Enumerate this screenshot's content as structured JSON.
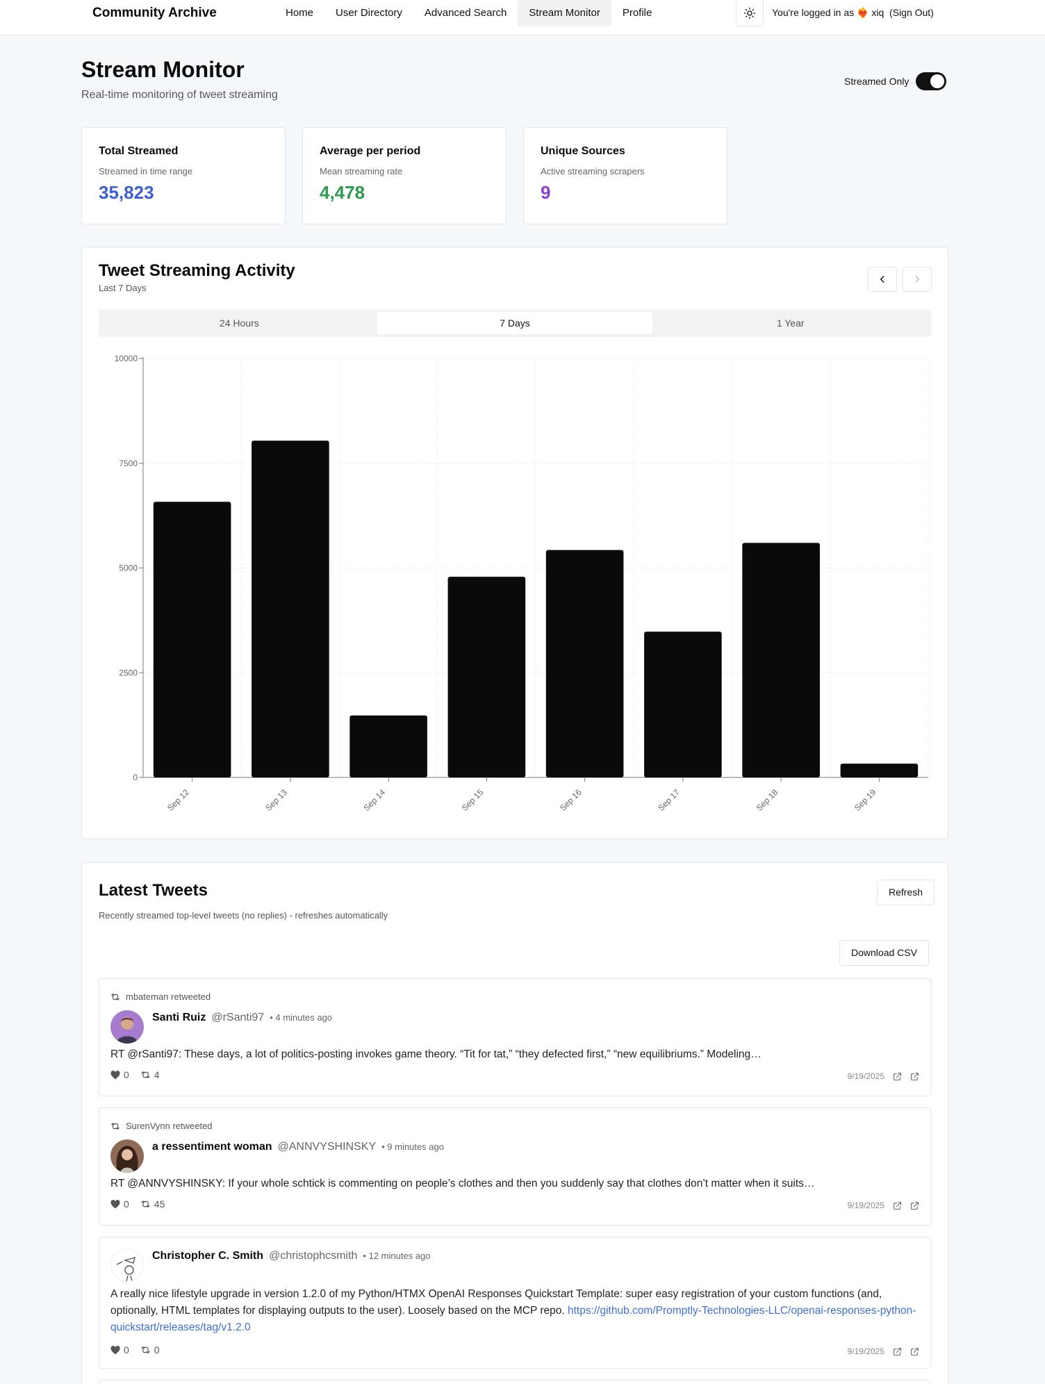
{
  "nav": {
    "brand": "Community Archive",
    "links": [
      {
        "label": "Home"
      },
      {
        "label": "User Directory"
      },
      {
        "label": "Advanced Search"
      },
      {
        "label": "Stream Monitor",
        "active": true
      },
      {
        "label": "Profile"
      }
    ],
    "theme_icon": "sun-icon",
    "login_prefix": "You're logged in as",
    "login_emoji": "❤️‍🔥",
    "username": "xiq",
    "sign_out": "(Sign Out)"
  },
  "header": {
    "title": "Stream Monitor",
    "subtitle": "Real-time monitoring of tweet streaming",
    "toggle_label": "Streamed Only",
    "toggle_on": true
  },
  "stats": [
    {
      "title": "Total Streamed",
      "desc": "Streamed in time range",
      "value": "35,823",
      "color": "#3b5fd1"
    },
    {
      "title": "Average per period",
      "desc": "Mean streaming rate",
      "value": "4,478",
      "color": "#2d9a4f"
    },
    {
      "title": "Unique Sources",
      "desc": "Active streaming scrapers",
      "value": "9",
      "color": "#8a3fd1"
    }
  ],
  "chart_card": {
    "title": "Tweet Streaming Activity",
    "subtitle": "Last 7 Days",
    "prev_icon": "chevron-left-icon",
    "next_icon": "chevron-right-icon",
    "tabs": [
      {
        "label": "24 Hours"
      },
      {
        "label": "7 Days",
        "active": true
      },
      {
        "label": "1 Year"
      }
    ]
  },
  "chart_data": {
    "type": "bar",
    "categories": [
      "Sep 12",
      "Sep 13",
      "Sep 14",
      "Sep 15",
      "Sep 16",
      "Sep 17",
      "Sep 18",
      "Sep 19"
    ],
    "values": [
      6580,
      8040,
      1480,
      4790,
      5430,
      3480,
      5600,
      330
    ],
    "ylim": [
      0,
      10000
    ],
    "yticks": [
      0,
      2500,
      5000,
      7500,
      10000
    ],
    "grid": true,
    "bar_color": "#0a0a0c"
  },
  "tweets_section": {
    "title": "Latest Tweets",
    "subtitle": "Recently streamed top-level tweets (no replies) - refreshes automatically",
    "refresh_label": "Refresh",
    "download_label": "Download CSV"
  },
  "tweets": [
    {
      "retweeted_by": "mbateman retweeted",
      "name": "Santi Ruiz",
      "handle": "@rSanti97",
      "time": "• 4 minutes ago",
      "text": "RT @rSanti97: These days, a lot of politics-posting invokes game theory. “Tit for tat,” “they defected first,” “new equilibriums.” Modeling…",
      "link": "",
      "likes": "0",
      "retweets": "4",
      "date": "9/19/2025",
      "avatar_color": "#a67ccf"
    },
    {
      "retweeted_by": "SurenVynn retweeted",
      "name": "a ressentiment woman",
      "handle": "@ANNVYSHINSKY",
      "time": "• 9 minutes ago",
      "text": "RT @ANNVYSHINSKY: If your whole schtick is commenting on people’s clothes and then you suddenly say that clothes don’t matter when it suits…",
      "link": "",
      "likes": "0",
      "retweets": "45",
      "date": "9/19/2025",
      "avatar_color": "#5b3a2e"
    },
    {
      "retweeted_by": "",
      "name": "Christopher C. Smith",
      "handle": "@christophcsmith",
      "time": "• 12 minutes ago",
      "text": "A really nice lifestyle upgrade in version 1.2.0 of my Python/HTMX OpenAI Responses Quickstart Template: super easy registration of your custom functions (and, optionally, HTML templates for displaying outputs to the user). Loosely based on the MCP repo. ",
      "link": "https://github.com/Promptly-Technologies-LLC/openai-responses-python-quickstart/releases/tag/v1.2.0",
      "likes": "0",
      "retweets": "0",
      "date": "9/19/2025",
      "avatar_color": "#ffffff"
    }
  ]
}
